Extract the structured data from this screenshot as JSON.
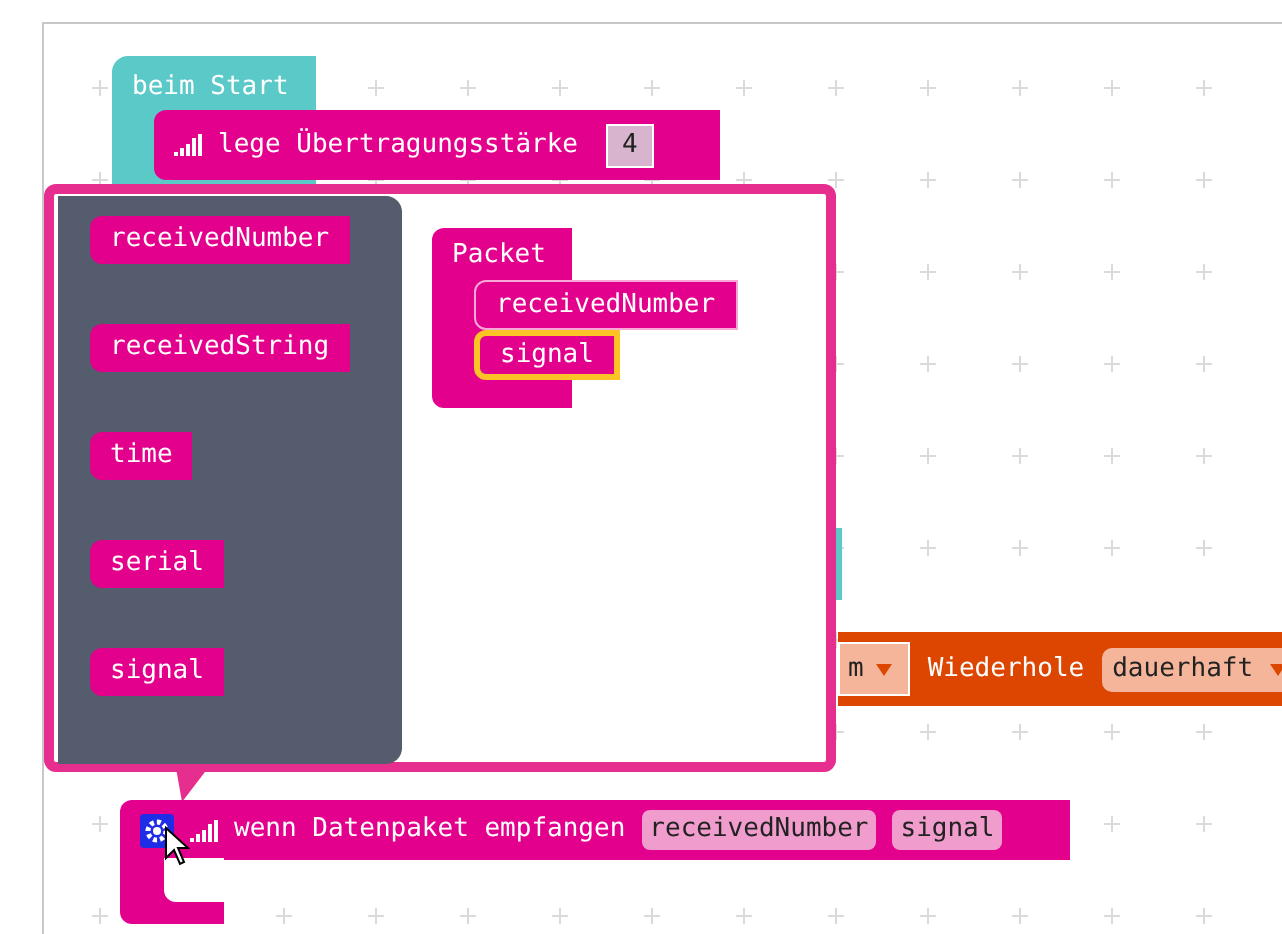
{
  "start_block": {
    "label": "beim Start"
  },
  "power_block": {
    "label": "lege Übertragungsstärke",
    "value": "4"
  },
  "loop_block": {
    "dropdown_1": "m",
    "label": "Wiederhole",
    "dropdown_2": "dauerhaft"
  },
  "mutator": {
    "flyout": [
      {
        "label": "receivedNumber"
      },
      {
        "label": "receivedString"
      },
      {
        "label": "time"
      },
      {
        "label": "serial"
      },
      {
        "label": "signal"
      }
    ],
    "container": {
      "label": "Packet",
      "items": [
        {
          "label": "receivedNumber",
          "selected": false
        },
        {
          "label": "signal",
          "selected": true
        }
      ]
    }
  },
  "event_block": {
    "label": "wenn Datenpaket empfangen",
    "params": [
      "receivedNumber",
      "signal"
    ]
  }
}
